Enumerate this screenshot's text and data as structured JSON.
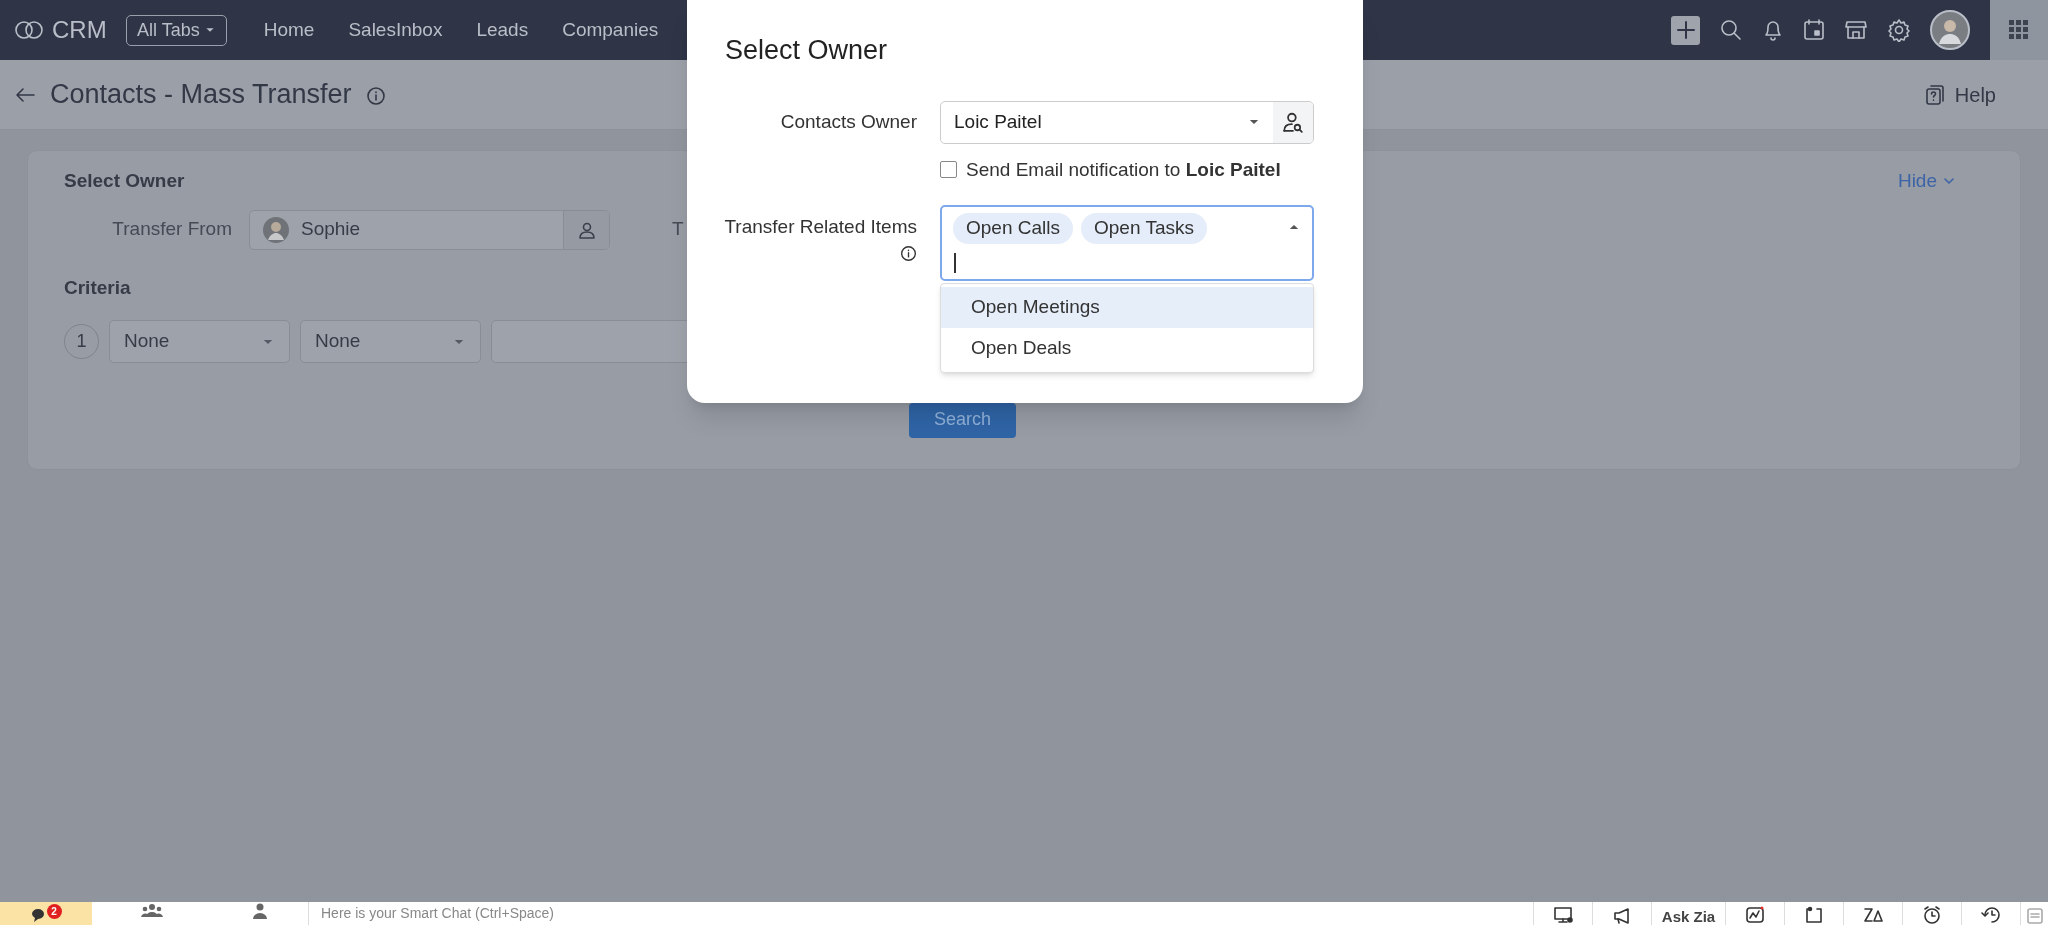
{
  "nav": {
    "logo": "CRM",
    "all_tabs": "All Tabs",
    "tabs": [
      "Home",
      "SalesInbox",
      "Leads",
      "Companies"
    ]
  },
  "header": {
    "title": "Contacts - Mass Transfer",
    "help": "Help"
  },
  "card": {
    "title": "Select Owner",
    "hide": "Hide",
    "transfer_from_label": "Transfer From",
    "transfer_from_value": "Sophie",
    "transfer_to_label": "T",
    "criteria_title": "Criteria",
    "criteria_rows": [
      {
        "number": "1",
        "field": "None",
        "operator": "None"
      }
    ],
    "search_button": "Search"
  },
  "modal": {
    "title": "Select Owner",
    "owner_label": "Contacts Owner",
    "owner_value": "Loic Paitel",
    "email_notification": {
      "text": "Send Email notification to **Loic Paitel**",
      "checked": false
    },
    "related_label": "Transfer Related Items",
    "expanded": true,
    "tags": [
      "Open Calls",
      "Open Tasks"
    ],
    "options": [
      {
        "label": "Open Meetings",
        "selected": true
      },
      {
        "label": "Open Deals",
        "selected": false
      }
    ]
  },
  "bottom_bar": {
    "badge": "2",
    "chat_placeholder": "Here is your Smart Chat (Ctrl+Space)",
    "ask_zia": "Ask Zia"
  }
}
